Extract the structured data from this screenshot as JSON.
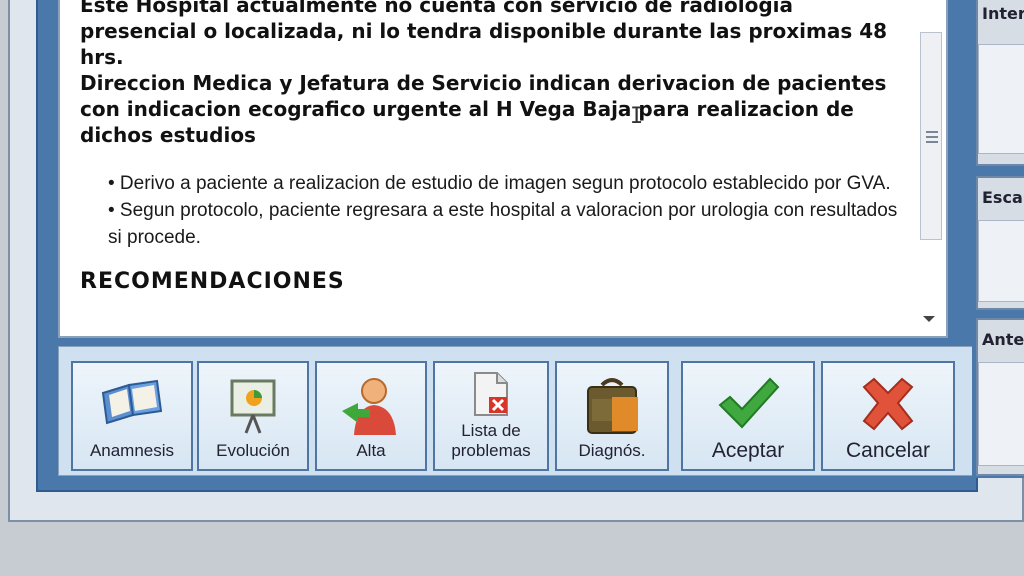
{
  "editor": {
    "paragraph_1": "Este Hospital actualmente no cuenta con servicio de radiologia\npresencial o localizada, ni lo tendra disponible durante las proximas 48\nhrs.\nDireccion Medica y Jefatura de Servicio indican derivacion de pacientes\ncon indicacion ecografico urgente al H Vega Baja para realizacion de\ndichos estudios",
    "bullets": [
      "• Derivo a paciente a realizacion de estudio de imagen segun protocolo establecido por GVA.",
      "• Segun protocolo, paciente regresara a este hospital a valoracion por urologia con resultados si procede."
    ],
    "section_heading": "RECOMENDACIONES"
  },
  "toolbar": {
    "anamnesis": "Anamnesis",
    "evolucion": "Evolución",
    "alta": "Alta",
    "lista_problemas_line1": "Lista de",
    "lista_problemas_line2": "problemas",
    "diagnos": "Diagnós.",
    "aceptar": "Aceptar",
    "cancelar": "Cancelar"
  },
  "right_panels": {
    "interconsultas": "Inter",
    "escalas": "Esca",
    "antecedentes": "Ante"
  },
  "icons": {
    "anamnesis": "open-book-icon",
    "evolucion": "presentation-board-icon",
    "alta": "person-discharge-icon",
    "lista_problemas": "document-delete-icon",
    "diagnos": "bag-icon",
    "aceptar": "checkmark-icon",
    "cancelar": "red-x-icon"
  },
  "colors": {
    "frame_blue": "#4a78aa",
    "button_border": "#4f76a3",
    "check_green": "#3fa83f",
    "cancel_red": "#e0533a"
  }
}
